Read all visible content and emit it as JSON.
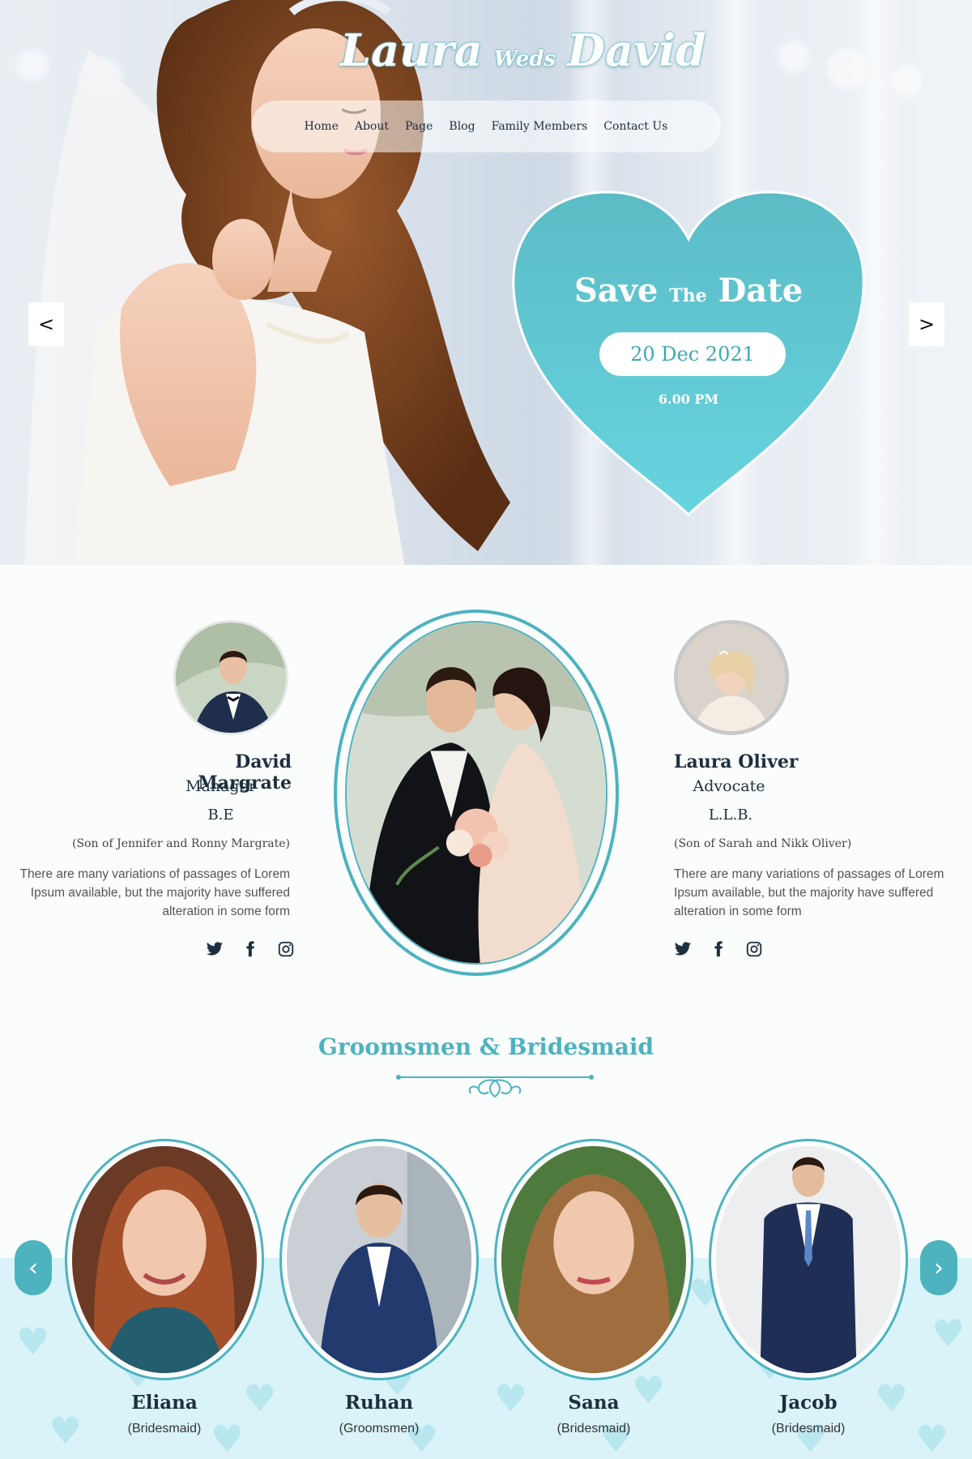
{
  "brand": {
    "name_left": "Laura",
    "weds": "Weds",
    "name_right": "David"
  },
  "nav": {
    "items": [
      "Home",
      "About",
      "Page",
      "Blog",
      "Family Members",
      "Contact Us"
    ]
  },
  "hero": {
    "prev_label": "<",
    "next_label": ">",
    "save": "Save",
    "the": "The",
    "date_word": "Date",
    "date": "20 Dec 2021",
    "time": "6.00 PM"
  },
  "groom": {
    "name": "David Margrate",
    "role": "Manager",
    "degree": "B.E",
    "parents": "(Son of  Jennifer  and  Ronny Margrate)",
    "desc": "There are many variations of passages of Lorem Ipsum available, but the majority have suffered alteration in some form"
  },
  "bride": {
    "name": "Laura Oliver",
    "role": "Advocate",
    "degree": "L.L.B.",
    "parents": "(Son of  Sarah and  Nikk Oliver)",
    "desc": "There are many variations of passages of Lorem Ipsum available, but the majority have suffered alteration in some form"
  },
  "team": {
    "title": "Groomsmen & Bridesmaid",
    "members": [
      {
        "name": "Eliana",
        "role": "(Bridesmaid)"
      },
      {
        "name": "Ruhan",
        "role": "(Groomsmen)"
      },
      {
        "name": "Sana",
        "role": "(Bridesmaid)"
      },
      {
        "name": "Jacob",
        "role": "(Bridesmaid)"
      }
    ],
    "prev_label": "‹",
    "next_label": "›"
  },
  "colors": {
    "accent": "#4cb3bf",
    "heart": "#5cc3ce",
    "navy": "#1c2f3e",
    "pattern_bg": "#d9f3f8"
  },
  "icons": [
    "twitter-icon",
    "facebook-icon",
    "instagram-icon"
  ]
}
